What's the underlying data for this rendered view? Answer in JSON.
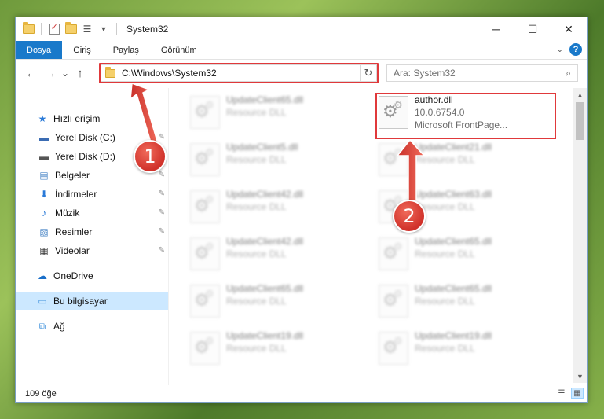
{
  "window": {
    "title": "System32",
    "controls": {
      "minimize": "─",
      "maximize": "☐",
      "close": "✕"
    }
  },
  "ribbon": {
    "tabs": [
      "Dosya",
      "Giriş",
      "Paylaş",
      "Görünüm"
    ],
    "help": "?"
  },
  "navigation": {
    "back": "←",
    "forward": "→",
    "recent": "⌄",
    "up": "↑",
    "address": "C:\\Windows\\System32",
    "refresh": "↻",
    "search_placeholder": "Ara: System32",
    "search_icon": "⌕"
  },
  "sidebar": {
    "items": [
      {
        "label": "Hızlı erişim",
        "icon": "star-icon",
        "glyph": "★",
        "color": "#2a7ad8"
      },
      {
        "label": "Yerel Disk (C:)",
        "icon": "drive-icon",
        "glyph": "▬",
        "color": "#3b6cb3",
        "pinned": true
      },
      {
        "label": "Yerel Disk (D:)",
        "icon": "drive-icon",
        "glyph": "▬",
        "color": "#555555",
        "pinned": true
      },
      {
        "label": "Belgeler",
        "icon": "documents-icon",
        "glyph": "▤",
        "color": "#4a86c6",
        "pinned": true
      },
      {
        "label": "İndirmeler",
        "icon": "downloads-icon",
        "glyph": "⬇",
        "color": "#2a7ad8",
        "pinned": true
      },
      {
        "label": "Müzik",
        "icon": "music-icon",
        "glyph": "♪",
        "color": "#2a7ad8",
        "pinned": true
      },
      {
        "label": "Resimler",
        "icon": "pictures-icon",
        "glyph": "▧",
        "color": "#4a86c6",
        "pinned": true
      },
      {
        "label": "Videolar",
        "icon": "videos-icon",
        "glyph": "▦",
        "color": "#333333",
        "pinned": true
      },
      {
        "label": "OneDrive",
        "icon": "onedrive-icon",
        "glyph": "☁",
        "color": "#1a6fc9"
      },
      {
        "label": "Bu bilgisayar",
        "icon": "computer-icon",
        "glyph": "▭",
        "color": "#3b8fdb",
        "selected": true
      },
      {
        "label": "Ağ",
        "icon": "network-icon",
        "glyph": "⧉",
        "color": "#3b8fdb"
      }
    ],
    "pin_glyph": "📌"
  },
  "files": {
    "left_column": [
      {
        "name": "UpdateClient65.dll",
        "desc": "Resource DLL"
      },
      {
        "name": "UpdateClient5.dll",
        "desc": "Resource DLL"
      },
      {
        "name": "UpdateClient42.dll",
        "desc": "Resource DLL"
      },
      {
        "name": "UpdateClient42.dll",
        "desc": "Resource DLL"
      },
      {
        "name": "UpdateClient65.dll",
        "desc": "Resource DLL"
      },
      {
        "name": "UpdateClient19.dll",
        "desc": "Resource DLL"
      }
    ],
    "right_column": [
      {
        "name": "author.dll",
        "version": "10.0.6754.0",
        "desc": "Microsoft FrontPage...",
        "highlighted": true
      },
      {
        "name": "UpdateClient21.dll",
        "desc": "Resource DLL"
      },
      {
        "name": "UpdateClient63.dll",
        "desc": "Resource DLL"
      },
      {
        "name": "UpdateClient65.dll",
        "desc": "Resource DLL"
      },
      {
        "name": "UpdateClient65.dll",
        "desc": "Resource DLL"
      },
      {
        "name": "UpdateClient19.dll",
        "desc": "Resource DLL"
      }
    ]
  },
  "status": {
    "count": "109 öğe"
  },
  "annotations": {
    "badge1": "1",
    "badge2": "2",
    "color": "#e0393b"
  }
}
